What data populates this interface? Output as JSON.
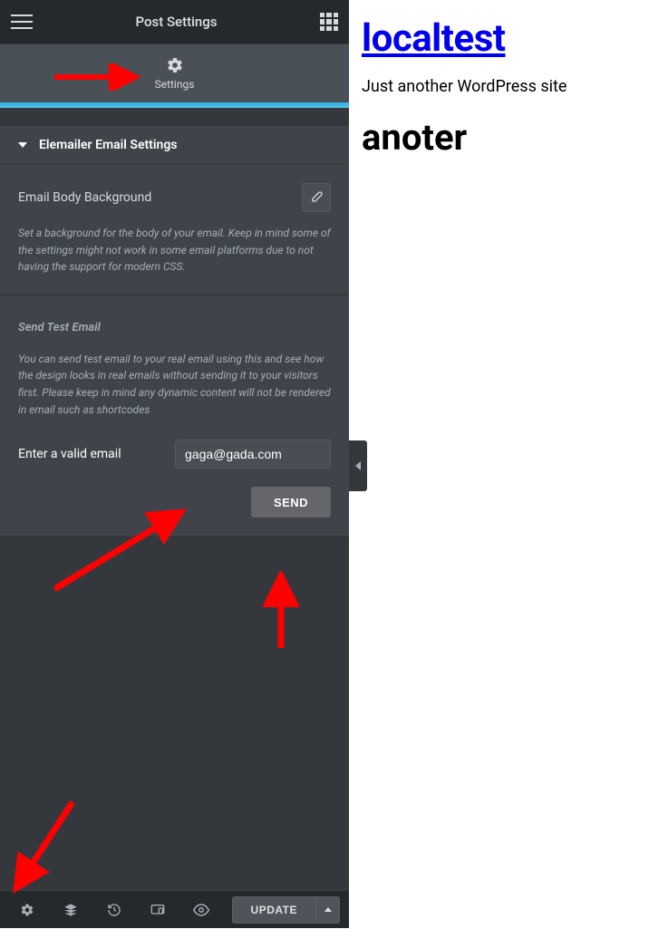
{
  "topbar": {
    "title": "Post Settings"
  },
  "tab": {
    "label": "Settings"
  },
  "accordion": {
    "title": "Elemailer Email Settings"
  },
  "bodyBg": {
    "label": "Email Body Background",
    "desc": "Set a background for the body of your email. Keep in mind some of the settings might not work in some email platforms due to not having the support for modern CSS."
  },
  "testEmail": {
    "header": "Send Test Email",
    "desc": "You can send test email to your real email using this and see how the design looks in real emails without sending it to your visitors first. Please keep in mind any dynamic content will not be rendered in email such as shortcodes",
    "inputLabel": "Enter a valid email",
    "inputValue": "gaga@gada.com",
    "sendLabel": "SEND"
  },
  "bottombar": {
    "update": "UPDATE"
  },
  "preview": {
    "siteTitle": "localtest",
    "tagline": "Just another WordPress site",
    "heading": "anoter"
  }
}
